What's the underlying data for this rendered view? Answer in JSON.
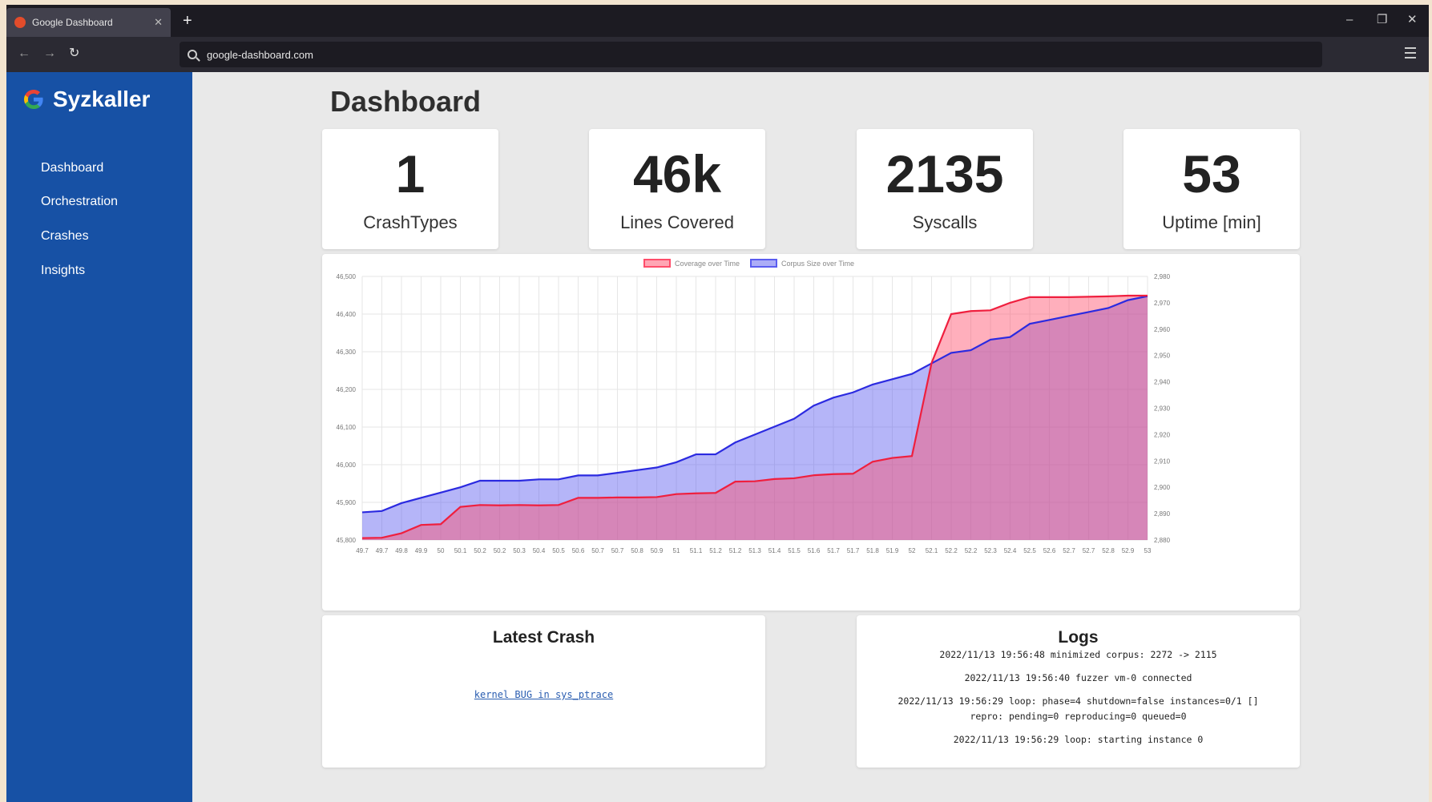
{
  "browser": {
    "tab_title": "Google Dashboard",
    "url": "google-dashboard.com"
  },
  "sidebar": {
    "brand": "Syzkaller",
    "items": [
      {
        "label": "Dashboard"
      },
      {
        "label": "Orchestration"
      },
      {
        "label": "Crashes"
      },
      {
        "label": "Insights"
      }
    ]
  },
  "page": {
    "title": "Dashboard"
  },
  "stats": [
    {
      "value": "1",
      "label": "CrashTypes"
    },
    {
      "value": "46k",
      "label": "Lines Covered"
    },
    {
      "value": "2135",
      "label": "Syscalls"
    },
    {
      "value": "53",
      "label": "Uptime [min]"
    }
  ],
  "chart_data": {
    "type": "area",
    "title": "",
    "xlabel": "",
    "ylabel": "",
    "x": [
      "49.7",
      "49.7",
      "49.8",
      "49.9",
      "50",
      "50.1",
      "50.2",
      "50.2",
      "50.3",
      "50.4",
      "50.5",
      "50.6",
      "50.7",
      "50.7",
      "50.8",
      "50.9",
      "51",
      "51.1",
      "51.2",
      "51.2",
      "51.3",
      "51.4",
      "51.5",
      "51.6",
      "51.7",
      "51.7",
      "51.8",
      "51.9",
      "52",
      "52.1",
      "52.2",
      "52.2",
      "52.3",
      "52.4",
      "52.5",
      "52.6",
      "52.7",
      "52.7",
      "52.8",
      "52.9",
      "53"
    ],
    "y_left": {
      "range": [
        45800,
        46500
      ],
      "ticks": [
        "45,800",
        "45,900",
        "46,000",
        "46,100",
        "46,200",
        "46,300",
        "46,400",
        "46,500"
      ]
    },
    "y_right": {
      "range": [
        2880,
        2980
      ],
      "ticks": [
        "2,880",
        "2,890",
        "2,900",
        "2,910",
        "2,920",
        "2,930",
        "2,940",
        "2,950",
        "2,960",
        "2,970",
        "2,980"
      ]
    },
    "grid": true,
    "legend_position": "top",
    "series": [
      {
        "name": "Coverage over Time",
        "axis": "left",
        "color": "#ff4d6a",
        "values": [
          45805,
          45806,
          45818,
          45840,
          45842,
          45888,
          45893,
          45892,
          45893,
          45892,
          45893,
          45912,
          45912,
          45913,
          45913,
          45914,
          45922,
          45924,
          45925,
          45955,
          45956,
          45962,
          45964,
          45972,
          45975,
          45976,
          46008,
          46018,
          46023,
          46270,
          46400,
          46408,
          46410,
          46430,
          46445,
          46445,
          46445,
          46446,
          46447,
          46449,
          46449
        ]
      },
      {
        "name": "Corpus Size over Time",
        "axis": "right",
        "color": "#5a5cf0",
        "values": [
          2890.5,
          2891,
          2894,
          2896,
          2898,
          2900,
          2902.5,
          2902.5,
          2902.5,
          2903,
          2903,
          2904.5,
          2904.5,
          2905.5,
          2906.5,
          2907.5,
          2909.5,
          2912.5,
          2912.5,
          2917,
          2920,
          2923,
          2926,
          2931,
          2934,
          2936,
          2939,
          2941,
          2943,
          2947,
          2951,
          2952,
          2956,
          2957,
          2962,
          2963.5,
          2965,
          2966.5,
          2968,
          2971,
          2972.5
        ]
      }
    ]
  },
  "latest_crash": {
    "title": "Latest Crash",
    "link": "kernel BUG in sys_ptrace"
  },
  "logs": {
    "title": "Logs",
    "lines": [
      "2022/11/13 19:56:48 minimized corpus: 2272 -> 2115",
      "2022/11/13 19:56:40 fuzzer vm-0 connected",
      "2022/11/13 19:56:29 loop: phase=4 shutdown=false instances=0/1 [] repro: pending=0 reproducing=0 queued=0",
      "2022/11/13 19:56:29 loop: starting instance 0"
    ]
  }
}
